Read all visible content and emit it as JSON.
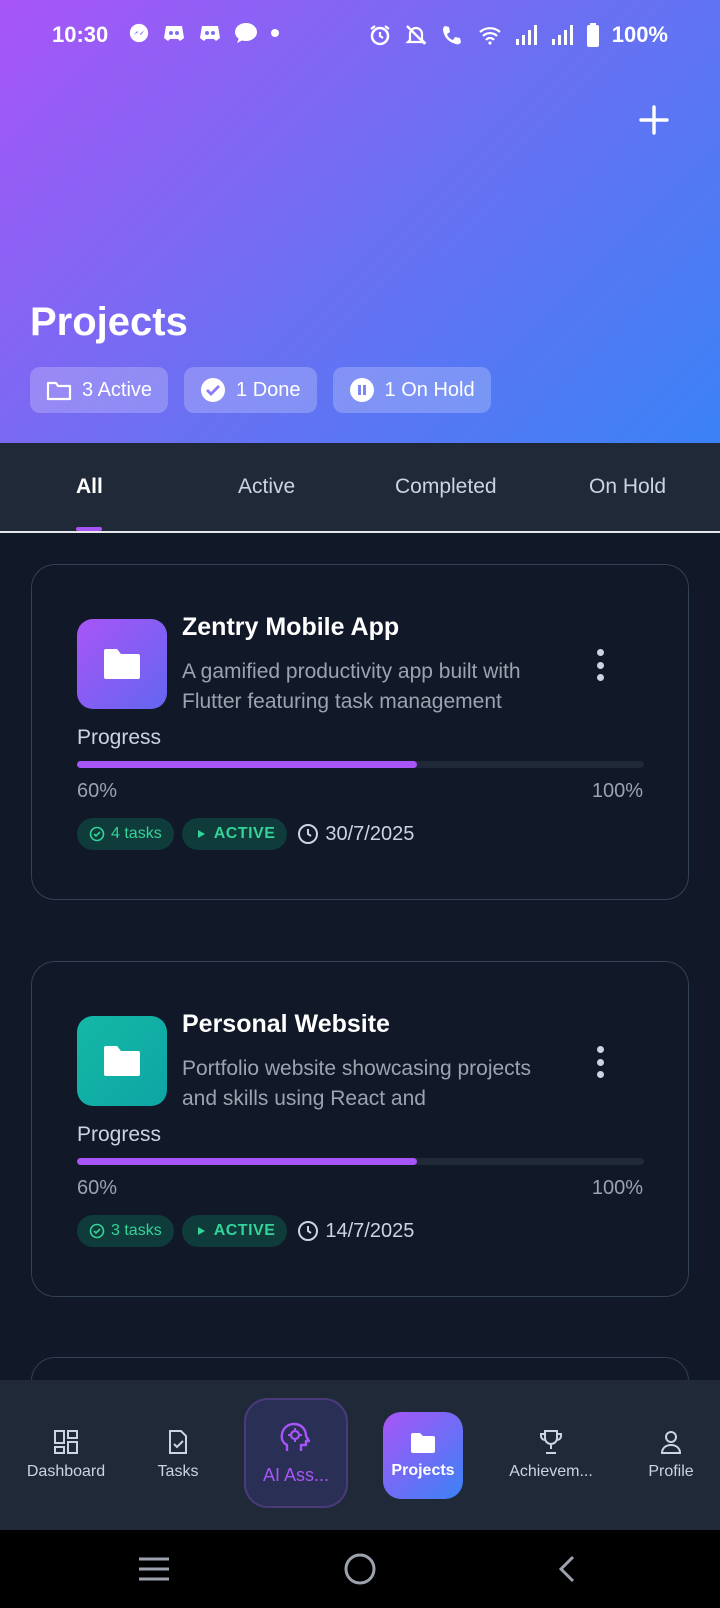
{
  "status_bar": {
    "time": "10:30",
    "battery": "100%",
    "left_icons": [
      "messenger-icon",
      "discord-icon",
      "discord-icon",
      "chat-icon",
      "dot-icon"
    ],
    "right_icons": [
      "alarm-icon",
      "mute-icon",
      "wifi-calling-icon",
      "wifi-icon",
      "signal-icon",
      "signal-icon",
      "battery-icon"
    ]
  },
  "header": {
    "title": "Projects",
    "add_icon": "plus-icon",
    "chips": [
      {
        "label": "3 Active",
        "icon": "folder-icon"
      },
      {
        "label": "1 Done",
        "icon": "check-circle-icon"
      },
      {
        "label": "1 On Hold",
        "icon": "pause-circle-icon"
      }
    ]
  },
  "tabs": [
    {
      "label": "All",
      "active": true
    },
    {
      "label": "Active",
      "active": false
    },
    {
      "label": "Completed",
      "active": false
    },
    {
      "label": "On Hold",
      "active": false
    }
  ],
  "projects": [
    {
      "title": "Zentry Mobile App",
      "description": "A gamified productivity app built with Flutter featuring task management",
      "icon_color": "#8b5cf6",
      "progress_label": "Progress",
      "progress": 0.6,
      "progress_text": "60%",
      "progress_max": "100%",
      "tasks": "4 tasks",
      "status": "ACTIVE",
      "date": "30/7/2025"
    },
    {
      "title": "Personal Website",
      "description": "Portfolio website showcasing projects and skills using React and",
      "icon_color": "#14b8a6",
      "progress_label": "Progress",
      "progress": 0.6,
      "progress_text": "60%",
      "progress_max": "100%",
      "tasks": "3 tasks",
      "status": "ACTIVE",
      "date": "14/7/2025"
    }
  ],
  "bottom_nav": [
    {
      "label": "Dashboard",
      "icon": "dashboard-icon"
    },
    {
      "label": "Tasks",
      "icon": "task-check-icon"
    },
    {
      "label": "AI Ass...",
      "icon": "ai-brain-icon"
    },
    {
      "label": "Projects",
      "icon": "folder-icon",
      "active": true
    },
    {
      "label": "Achievem...",
      "icon": "trophy-icon"
    },
    {
      "label": "Profile",
      "icon": "person-icon"
    }
  ],
  "colors": {
    "accent": "#a855f7",
    "header_start": "#a855f7",
    "header_end": "#3b82f6",
    "background": "#111827",
    "status_green": "#34d399"
  }
}
